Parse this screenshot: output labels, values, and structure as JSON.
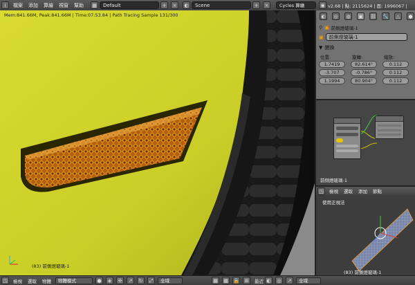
{
  "topbar": {
    "menus": [
      "檔案",
      "添加",
      "算繪",
      "視窗",
      "幫助"
    ],
    "layout_value": "Default",
    "scene_value": "Scene",
    "engine_value": "Cycles 算繪",
    "info_text": "v2.68 | 點: 2115624 | 面: 1996067 |"
  },
  "viewport": {
    "stats_text": "Mem:841.66M, Peak:841.66M | Time:07:53.84 | Path Tracing Sample 131/300",
    "object_label": "(83) 前側燈玻璃-1"
  },
  "properties": {
    "object_name": "前側燈玻璃-1",
    "name_field": "前側燈玻璃-1",
    "section_title": "變換",
    "location_label": "位置:",
    "rotation_label": "旋轉:",
    "scale_label": "縮放:",
    "location_values": [
      "1.7419",
      "-3.707",
      "1.1994"
    ],
    "rotation_values": [
      "82.614°",
      "-0.786°",
      "80.904°"
    ],
    "scale_values": [
      "0.112",
      "0.112",
      "0.112"
    ]
  },
  "node_editor": {
    "object_label": "前側燈玻璃-1"
  },
  "view3": {
    "menus": [
      "檢視",
      "選取",
      "添加",
      "節點"
    ],
    "view_label": "使用正視法",
    "object_label": "(83) 前側燈玻璃-1"
  },
  "bottombar": {
    "menus": [
      "檢視",
      "選取",
      "物體"
    ],
    "mode_value": "物體模式",
    "global_value": "全域",
    "global_value2": "全域",
    "right_label": "最近"
  }
}
